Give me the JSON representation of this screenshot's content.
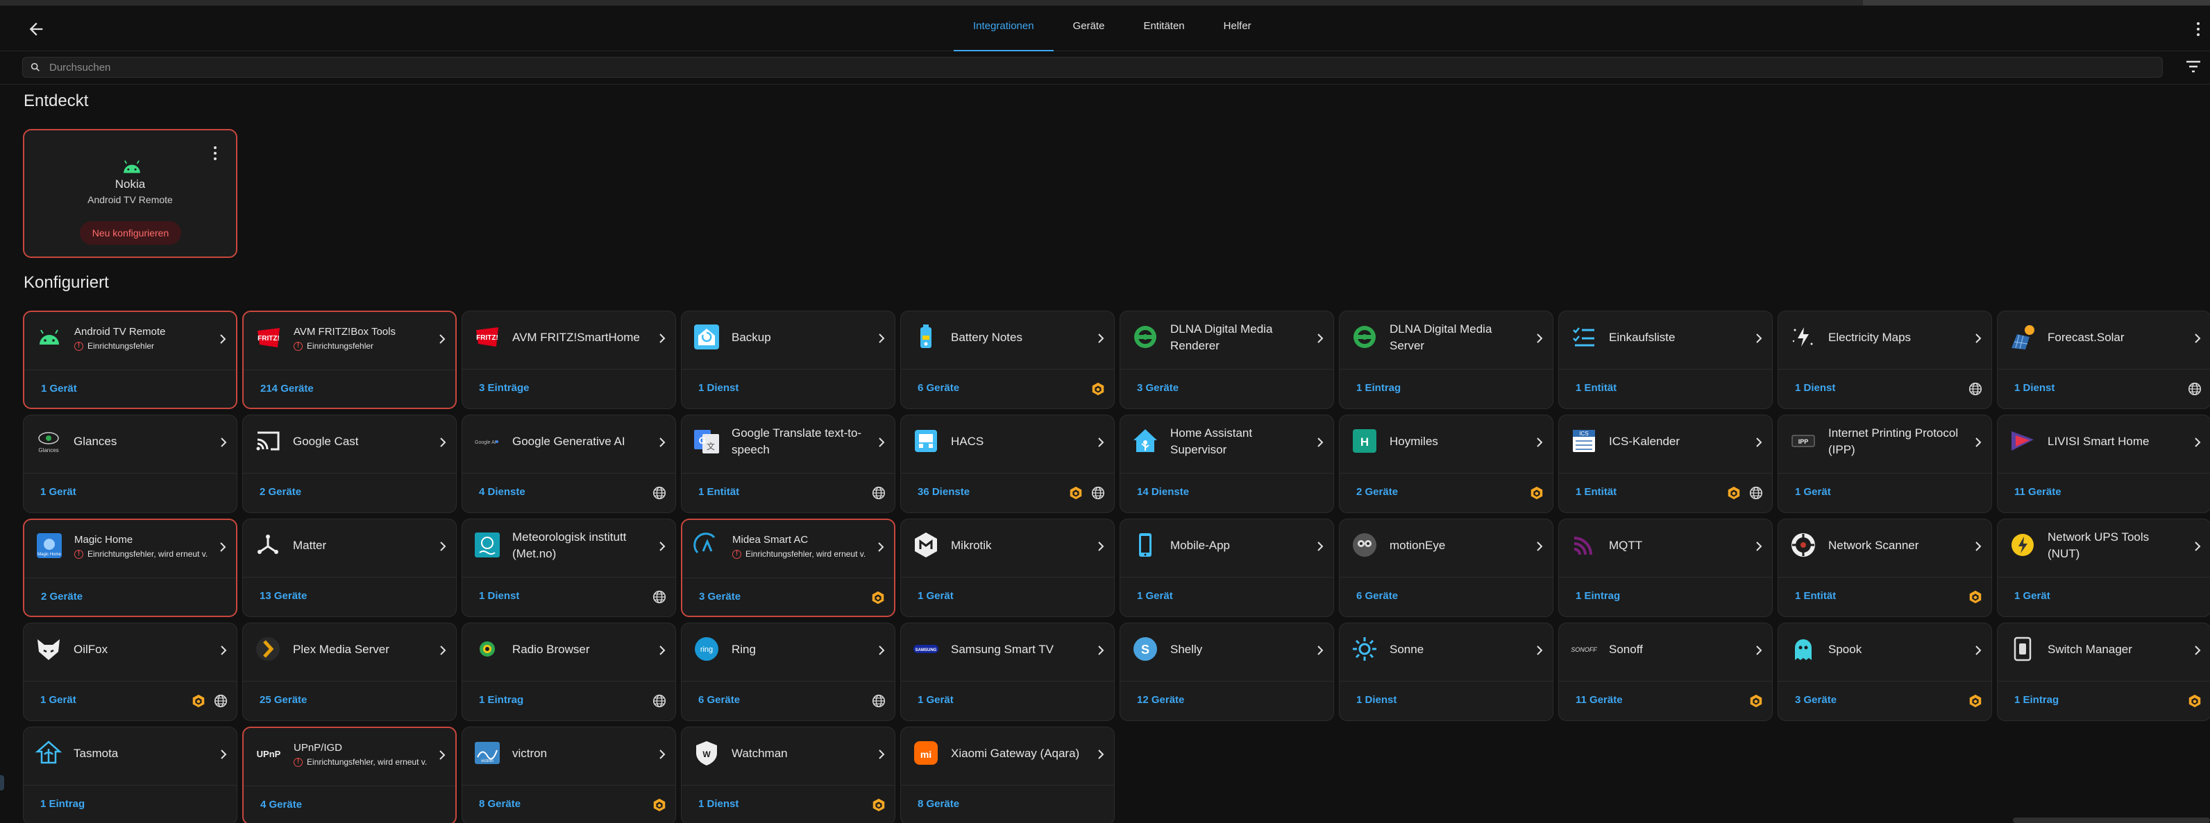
{
  "tabs": [
    {
      "label": "Integrationen",
      "active": true
    },
    {
      "label": "Geräte",
      "active": false
    },
    {
      "label": "Entitäten",
      "active": false
    },
    {
      "label": "Helfer",
      "active": false
    }
  ],
  "search": {
    "placeholder": "Durchsuchen",
    "value": ""
  },
  "discovered": {
    "title": "Entdeckt",
    "card": {
      "name": "Nokia",
      "subtitle": "Android TV Remote",
      "button": "Neu konfigurieren",
      "icon": "android-icon"
    }
  },
  "configured": {
    "title": "Konfiguriert",
    "cards": [
      {
        "title": "Android TV Remote",
        "error": "Einrichtungsfehler",
        "count": "1 Gerät",
        "icon": "android-icon",
        "badges": []
      },
      {
        "title": "AVM FRITZ!Box Tools",
        "error": "Einrichtungsfehler",
        "count": "214 Geräte",
        "icon": "fritz-icon",
        "badges": []
      },
      {
        "title": "AVM FRITZ!SmartHome",
        "error": "",
        "count": "3 Einträge",
        "icon": "fritz-icon",
        "badges": []
      },
      {
        "title": "Backup",
        "error": "",
        "count": "1 Dienst",
        "icon": "backup-icon",
        "badges": []
      },
      {
        "title": "Battery Notes",
        "error": "",
        "count": "6 Geräte",
        "icon": "battery-icon",
        "badges": [
          "custom"
        ]
      },
      {
        "title": "DLNA Digital Media Renderer",
        "error": "",
        "count": "3 Geräte",
        "icon": "dlna-icon",
        "badges": []
      },
      {
        "title": "DLNA Digital Media Server",
        "error": "",
        "count": "1 Eintrag",
        "icon": "dlna-icon",
        "badges": []
      },
      {
        "title": "Einkaufsliste",
        "error": "",
        "count": "1 Entität",
        "icon": "shopping-list-icon",
        "badges": []
      },
      {
        "title": "Electricity Maps",
        "error": "",
        "count": "1 Dienst",
        "icon": "electricity-maps-icon",
        "badges": [
          "cloud"
        ]
      },
      {
        "title": "Forecast.Solar",
        "error": "",
        "count": "1 Dienst",
        "icon": "solar-icon",
        "badges": [
          "cloud"
        ]
      },
      {
        "title": "Glances",
        "error": "",
        "count": "1 Gerät",
        "icon": "glances-icon",
        "badges": []
      },
      {
        "title": "Google Cast",
        "error": "",
        "count": "2 Geräte",
        "icon": "cast-icon",
        "badges": []
      },
      {
        "title": "Google Generative AI",
        "error": "",
        "count": "4 Dienste",
        "icon": "google-ai-icon",
        "badges": [
          "cloud"
        ]
      },
      {
        "title": "Google Translate text-to-speech",
        "error": "",
        "count": "1 Entität",
        "icon": "google-translate-icon",
        "badges": [
          "cloud"
        ]
      },
      {
        "title": "HACS",
        "error": "",
        "count": "36 Dienste",
        "icon": "hacs-icon",
        "badges": [
          "custom",
          "cloud"
        ]
      },
      {
        "title": "Home Assistant Supervisor",
        "error": "",
        "count": "14 Dienste",
        "icon": "home-assistant-icon",
        "badges": []
      },
      {
        "title": "Hoymiles",
        "error": "",
        "count": "2 Geräte",
        "icon": "hoymiles-icon",
        "badges": [
          "custom"
        ]
      },
      {
        "title": "ICS-Kalender",
        "error": "",
        "count": "1 Entität",
        "icon": "ics-calendar-icon",
        "badges": [
          "custom",
          "cloud"
        ]
      },
      {
        "title": "Internet Printing Protocol (IPP)",
        "error": "",
        "count": "1 Gerät",
        "icon": "ipp-icon",
        "badges": []
      },
      {
        "title": "LIVISI Smart Home",
        "error": "",
        "count": "11 Geräte",
        "icon": "livisi-icon",
        "badges": []
      },
      {
        "title": "Magic Home",
        "error": "Einrichtungsfehler, wird erneut v...",
        "count": "2 Geräte",
        "icon": "magic-home-icon",
        "badges": []
      },
      {
        "title": "Matter",
        "error": "",
        "count": "13 Geräte",
        "icon": "matter-icon",
        "badges": []
      },
      {
        "title": "Meteorologisk institutt (Met.no)",
        "error": "",
        "count": "1 Dienst",
        "icon": "met-no-icon",
        "badges": [
          "cloud"
        ]
      },
      {
        "title": "Midea Smart AC",
        "error": "Einrichtungsfehler, wird erneut v...",
        "count": "3 Geräte",
        "icon": "midea-icon",
        "badges": [
          "custom"
        ]
      },
      {
        "title": "Mikrotik",
        "error": "",
        "count": "1 Gerät",
        "icon": "mikrotik-icon",
        "badges": []
      },
      {
        "title": "Mobile-App",
        "error": "",
        "count": "1 Gerät",
        "icon": "mobile-app-icon",
        "badges": []
      },
      {
        "title": "motionEye",
        "error": "",
        "count": "6 Geräte",
        "icon": "motioneye-icon",
        "badges": []
      },
      {
        "title": "MQTT",
        "error": "",
        "count": "1 Eintrag",
        "icon": "mqtt-icon",
        "badges": []
      },
      {
        "title": "Network Scanner",
        "error": "",
        "count": "1 Entität",
        "icon": "network-scanner-icon",
        "badges": [
          "custom"
        ]
      },
      {
        "title": "Network UPS Tools (NUT)",
        "error": "",
        "count": "1 Gerät",
        "icon": "nut-icon",
        "badges": []
      },
      {
        "title": "OilFox",
        "error": "",
        "count": "1 Gerät",
        "icon": "oilfox-icon",
        "badges": [
          "custom",
          "cloud"
        ]
      },
      {
        "title": "Plex Media Server",
        "error": "",
        "count": "25 Geräte",
        "icon": "plex-icon",
        "badges": []
      },
      {
        "title": "Radio Browser",
        "error": "",
        "count": "1 Eintrag",
        "icon": "radio-browser-icon",
        "badges": [
          "cloud"
        ]
      },
      {
        "title": "Ring",
        "error": "",
        "count": "6 Geräte",
        "icon": "ring-icon",
        "badges": [
          "cloud"
        ]
      },
      {
        "title": "Samsung Smart TV",
        "error": "",
        "count": "1 Gerät",
        "icon": "samsung-icon",
        "badges": []
      },
      {
        "title": "Shelly",
        "error": "",
        "count": "12 Geräte",
        "icon": "shelly-icon",
        "badges": []
      },
      {
        "title": "Sonne",
        "error": "",
        "count": "1 Dienst",
        "icon": "sun-icon",
        "badges": []
      },
      {
        "title": "Sonoff",
        "error": "",
        "count": "11 Geräte",
        "icon": "sonoff-icon",
        "badges": [
          "custom"
        ]
      },
      {
        "title": "Spook",
        "error": "",
        "count": "3 Geräte",
        "icon": "spook-icon",
        "badges": [
          "custom"
        ]
      },
      {
        "title": "Switch Manager",
        "error": "",
        "count": "1 Eintrag",
        "icon": "switch-manager-icon",
        "badges": [
          "custom"
        ]
      },
      {
        "title": "Tasmota",
        "error": "",
        "count": "1 Eintrag",
        "icon": "tasmota-icon",
        "badges": []
      },
      {
        "title": "UPnP/IGD",
        "error": "Einrichtungsfehler, wird erneut v...",
        "count": "4 Geräte",
        "icon": "upnp-icon",
        "badges": []
      },
      {
        "title": "victron",
        "error": "",
        "count": "8 Geräte",
        "icon": "victron-icon",
        "badges": [
          "custom"
        ]
      },
      {
        "title": "Watchman",
        "error": "",
        "count": "1 Dienst",
        "icon": "watchman-icon",
        "badges": [
          "custom"
        ]
      },
      {
        "title": "Xiaomi Gateway (Aqara)",
        "error": "",
        "count": "8 Geräte",
        "icon": "xiaomi-icon",
        "badges": []
      }
    ]
  },
  "colors": {
    "accent": "#3ea7f2",
    "error": "#e24a4a",
    "error_border": "#c8473e",
    "custom_badge": "#f5a623",
    "card_bg": "#1c1c1c",
    "page_bg": "#111111"
  }
}
